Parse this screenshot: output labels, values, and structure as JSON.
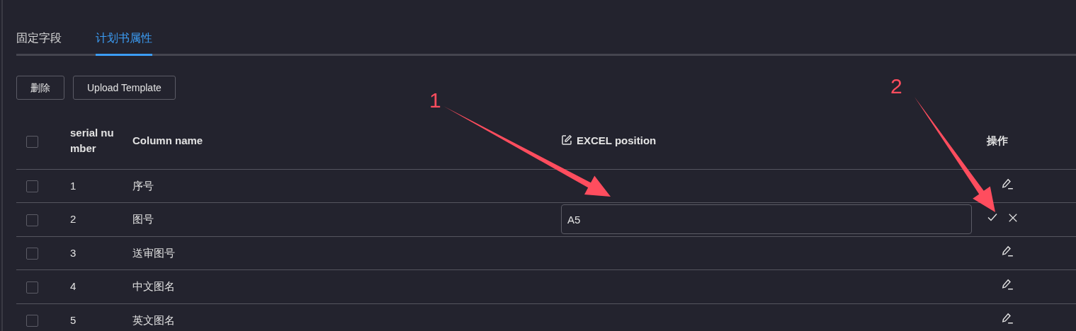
{
  "tabs": [
    {
      "label": "固定字段",
      "selected": false
    },
    {
      "label": "计划书属性",
      "selected": true
    }
  ],
  "toolbar": [
    "删除",
    "Upload Template"
  ],
  "table": {
    "select_all_checked": false,
    "columns": [
      {
        "kind": "select"
      },
      {
        "kind": "text",
        "label": "serial number"
      },
      {
        "kind": "text",
        "label": "Column name"
      },
      {
        "kind": "editable",
        "label": "EXCEL position"
      },
      {
        "kind": "actions",
        "label": "操作"
      }
    ],
    "rows": [
      {
        "checked": false,
        "number": "1",
        "name": "序号",
        "editing": false
      },
      {
        "checked": false,
        "number": "2",
        "name": "图号",
        "editing": true,
        "value": "A5"
      },
      {
        "checked": false,
        "number": "3",
        "name": "送审图号",
        "editing": false
      },
      {
        "checked": false,
        "number": "4",
        "name": "中文图名",
        "editing": false
      },
      {
        "checked": false,
        "number": "5",
        "name": "英文图名",
        "editing": false
      }
    ]
  },
  "annotations": [
    {
      "label": "1"
    },
    {
      "label": "2"
    }
  ]
}
